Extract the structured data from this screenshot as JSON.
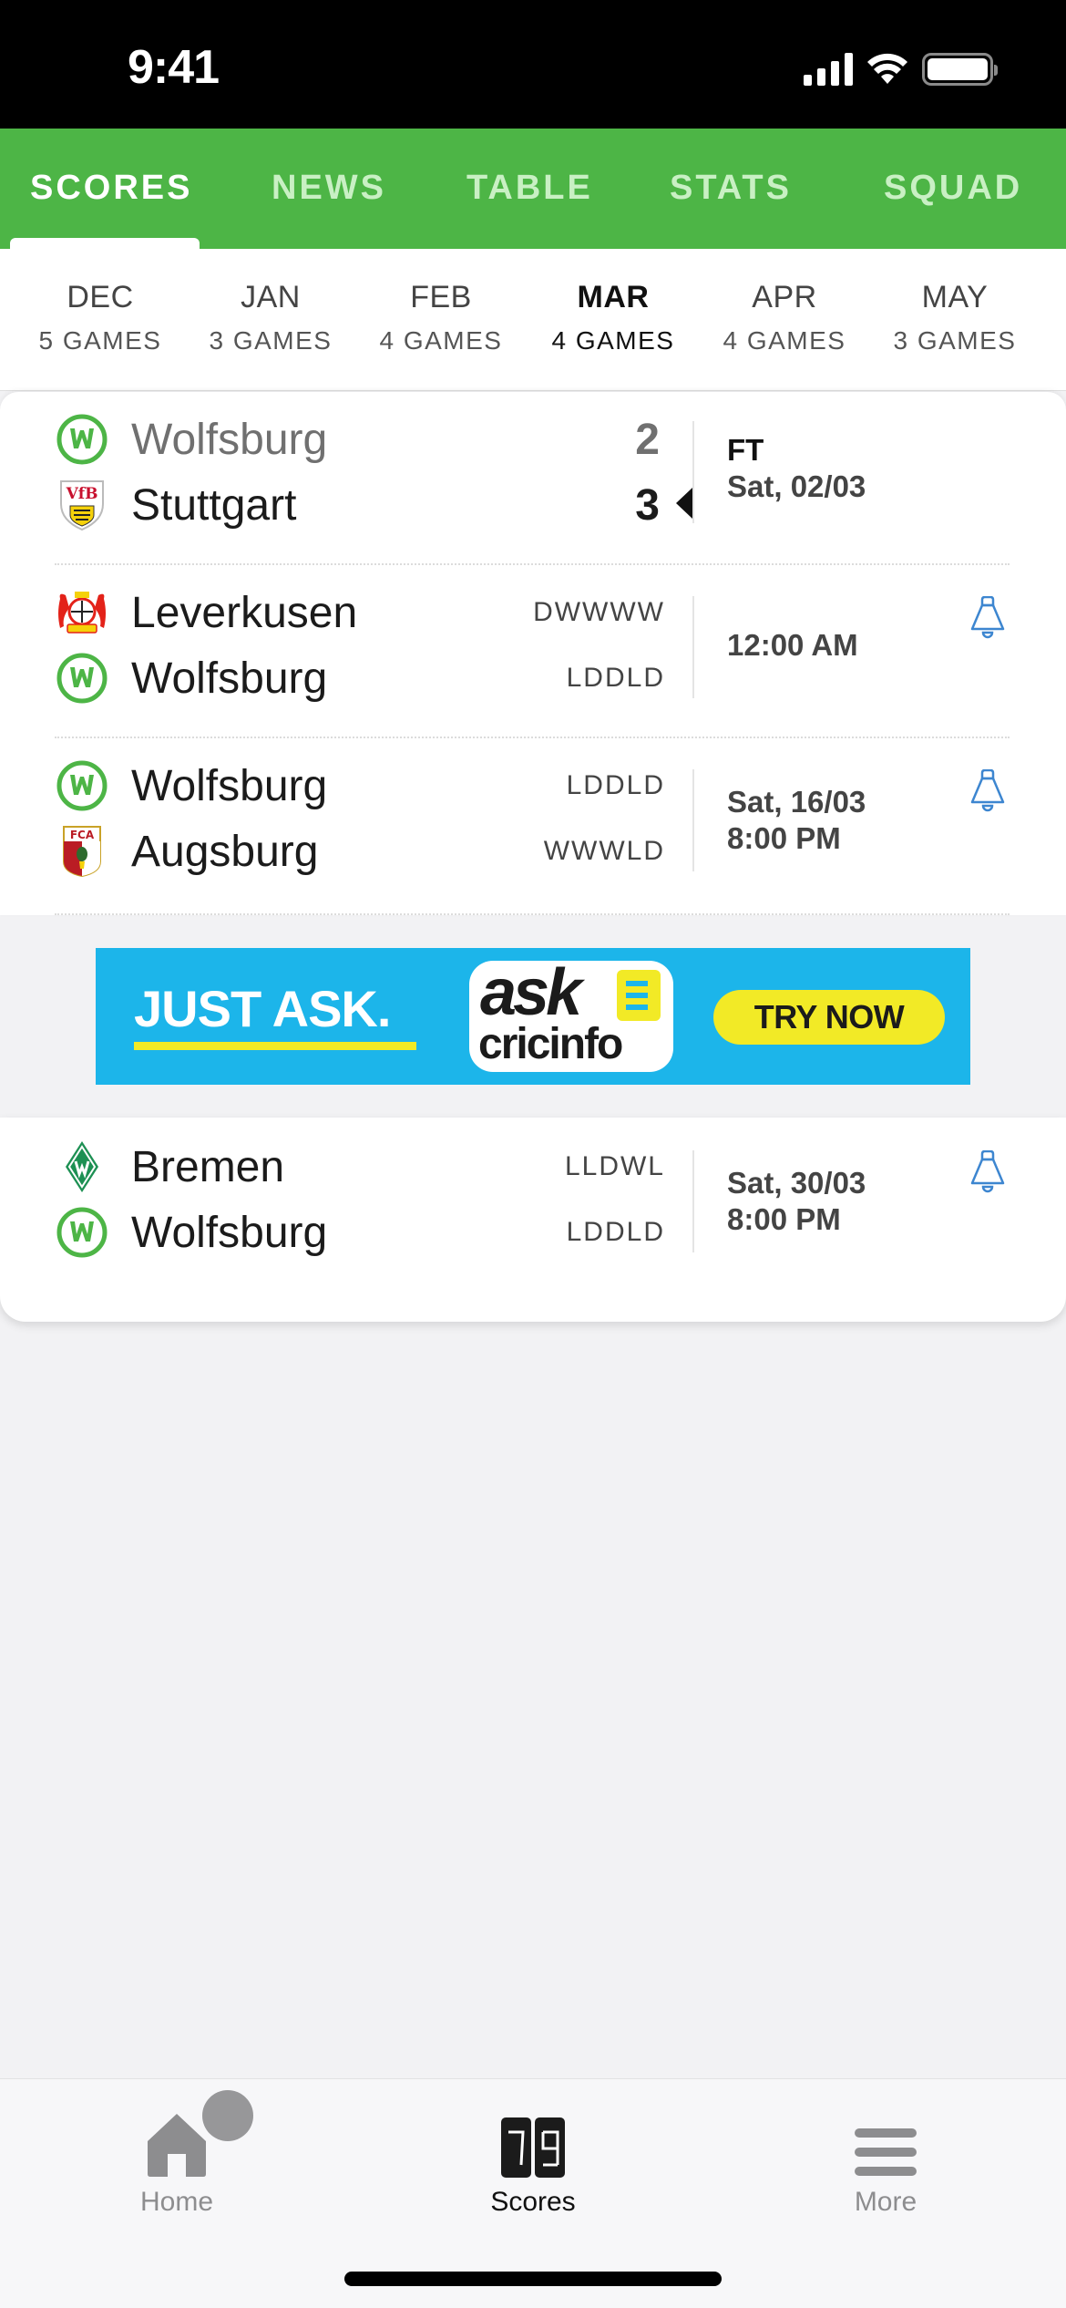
{
  "status_bar": {
    "time": "9:41",
    "icons": [
      "signal-icon",
      "wifi-icon",
      "battery-icon"
    ]
  },
  "top_tabs": [
    {
      "label": "SCORES",
      "active": true
    },
    {
      "label": "NEWS",
      "active": false
    },
    {
      "label": "TABLE",
      "active": false
    },
    {
      "label": "STATS",
      "active": false
    },
    {
      "label": "SQUAD",
      "active": false
    }
  ],
  "months": [
    {
      "name": "DEC",
      "games": "5 GAMES",
      "active": false
    },
    {
      "name": "JAN",
      "games": "3 GAMES",
      "active": false
    },
    {
      "name": "FEB",
      "games": "4 GAMES",
      "active": false
    },
    {
      "name": "MAR",
      "games": "4 GAMES",
      "active": true
    },
    {
      "name": "APR",
      "games": "4 GAMES",
      "active": false
    },
    {
      "name": "MAY",
      "games": "3 GAMES",
      "active": false
    }
  ],
  "matches": [
    {
      "home": {
        "name": "Wolfsburg",
        "crest": "wolfsburg-crest-icon",
        "score": "2"
      },
      "away": {
        "name": "Stuttgart",
        "crest": "stuttgart-crest-icon",
        "score": "3",
        "winner": true
      },
      "status": "FT",
      "date": "Sat, 02/03"
    },
    {
      "home": {
        "name": "Leverkusen",
        "crest": "leverkusen-crest-icon",
        "form": "DWWWW"
      },
      "away": {
        "name": "Wolfsburg",
        "crest": "wolfsburg-crest-icon",
        "form": "LDDLD"
      },
      "time": "12:00 AM",
      "alert_icon": "bell-icon"
    },
    {
      "home": {
        "name": "Wolfsburg",
        "crest": "wolfsburg-crest-icon",
        "form": "LDDLD"
      },
      "away": {
        "name": "Augsburg",
        "crest": "augsburg-crest-icon",
        "form": "WWWLD"
      },
      "date": "Sat, 16/03",
      "time": "8:00 PM",
      "alert_icon": "bell-icon"
    },
    {
      "home": {
        "name": "Bremen",
        "crest": "bremen-crest-icon",
        "form": "LLDWL"
      },
      "away": {
        "name": "Wolfsburg",
        "crest": "wolfsburg-crest-icon",
        "form": "LDDLD"
      },
      "date": "Sat, 30/03",
      "time": "8:00 PM",
      "alert_icon": "bell-icon"
    }
  ],
  "ad": {
    "headline": "JUST ASK.",
    "logo_top": "ask",
    "logo_bottom": "cricinfo",
    "cta": "TRY NOW"
  },
  "bottom_nav": [
    {
      "label": "Home",
      "icon": "home-icon",
      "active": false,
      "badge": true
    },
    {
      "label": "Scores",
      "icon": "scoreboard-icon",
      "active": true,
      "icon_digits": "79"
    },
    {
      "label": "More",
      "icon": "menu-icon",
      "active": false
    }
  ],
  "colors": {
    "brand_green": "#4db546",
    "bell_blue": "#3d86d0",
    "ad_blue": "#1cb5ea",
    "ad_yellow": "#f2ea26"
  }
}
